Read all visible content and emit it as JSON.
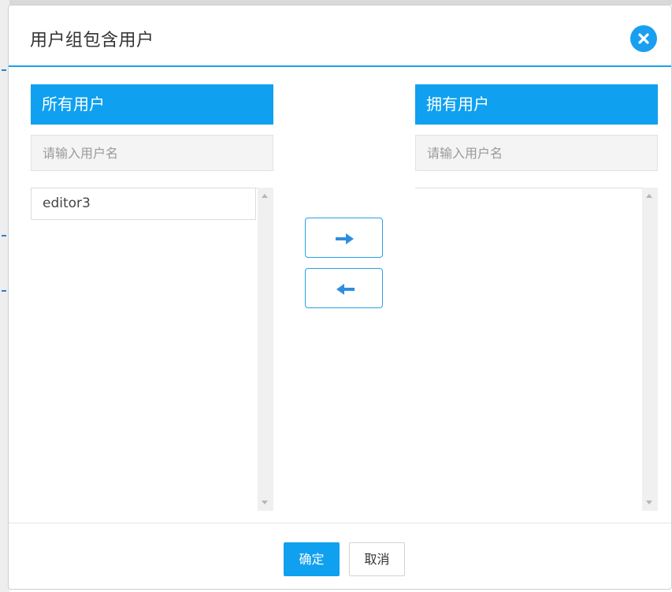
{
  "dialog": {
    "title": "用户组包含用户",
    "close_icon": "close-icon"
  },
  "left_panel": {
    "header": "所有用户",
    "search_placeholder": "请输入用户名",
    "items": [
      "editor3"
    ]
  },
  "right_panel": {
    "header": "拥有用户",
    "search_placeholder": "请输入用户名",
    "items": []
  },
  "transfer": {
    "move_right_icon": "arrow-right-icon",
    "move_left_icon": "arrow-left-icon"
  },
  "footer": {
    "confirm_label": "确定",
    "cancel_label": "取消"
  },
  "colors": {
    "accent": "#0fa0ef",
    "header_rule": "#1aa1ec",
    "arrow": "#2d8ee0"
  }
}
